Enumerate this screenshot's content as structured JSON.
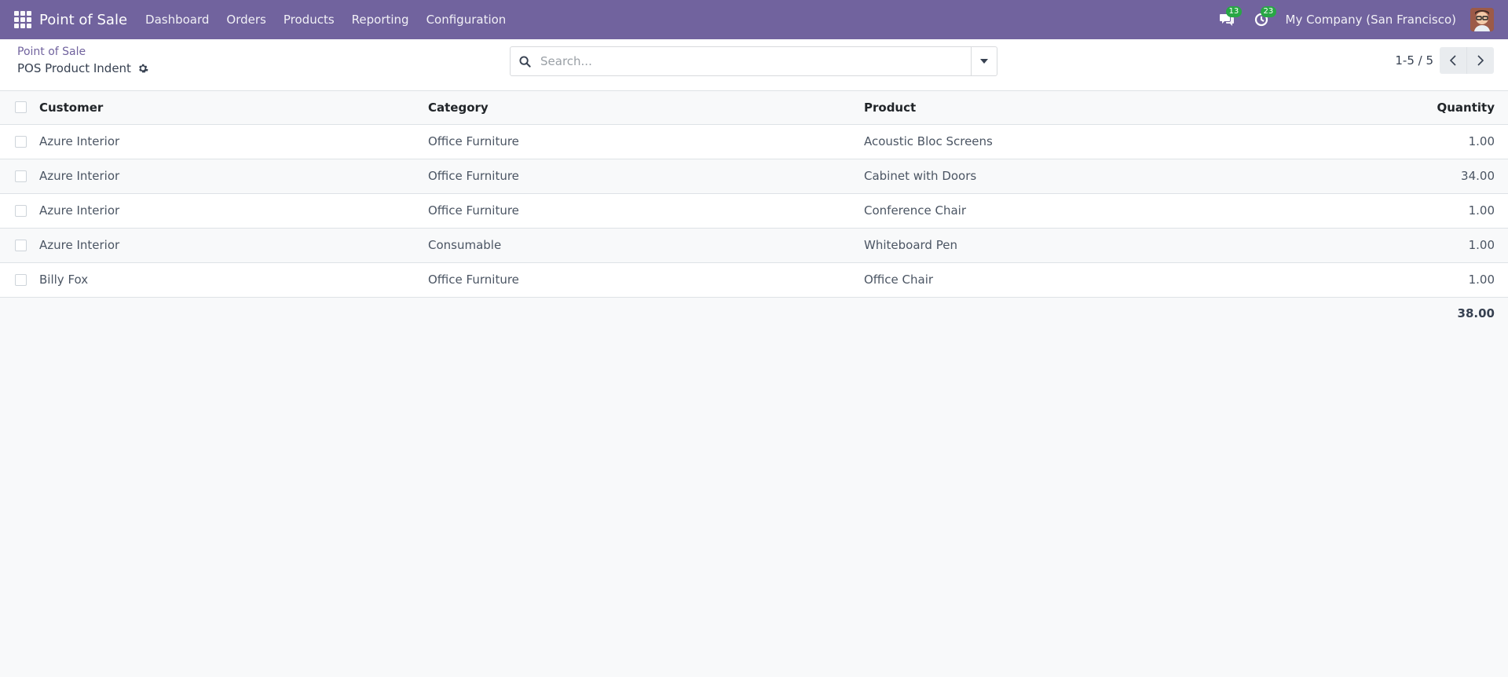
{
  "navbar": {
    "brand": "Point of Sale",
    "menu": [
      "Dashboard",
      "Orders",
      "Products",
      "Reporting",
      "Configuration"
    ],
    "messages_count": "13",
    "activities_count": "23",
    "company": "My Company (San Francisco)"
  },
  "control": {
    "breadcrumb": "Point of Sale",
    "title": "POS Product Indent",
    "search_placeholder": "Search...",
    "pager": "1-5 / 5"
  },
  "table": {
    "headers": {
      "customer": "Customer",
      "category": "Category",
      "product": "Product",
      "quantity": "Quantity"
    },
    "rows": [
      {
        "customer": "Azure Interior",
        "category": "Office Furniture",
        "product": "Acoustic Bloc Screens",
        "quantity": "1.00"
      },
      {
        "customer": "Azure Interior",
        "category": "Office Furniture",
        "product": "Cabinet with Doors",
        "quantity": "34.00"
      },
      {
        "customer": "Azure Interior",
        "category": "Office Furniture",
        "product": "Conference Chair",
        "quantity": "1.00"
      },
      {
        "customer": "Azure Interior",
        "category": "Consumable",
        "product": "Whiteboard Pen",
        "quantity": "1.00"
      },
      {
        "customer": "Billy Fox",
        "category": "Office Furniture",
        "product": "Office Chair",
        "quantity": "1.00"
      }
    ],
    "total_quantity": "38.00"
  },
  "colors": {
    "navbar": "#71639e",
    "badge": "#28a745",
    "link": "#71639e"
  }
}
